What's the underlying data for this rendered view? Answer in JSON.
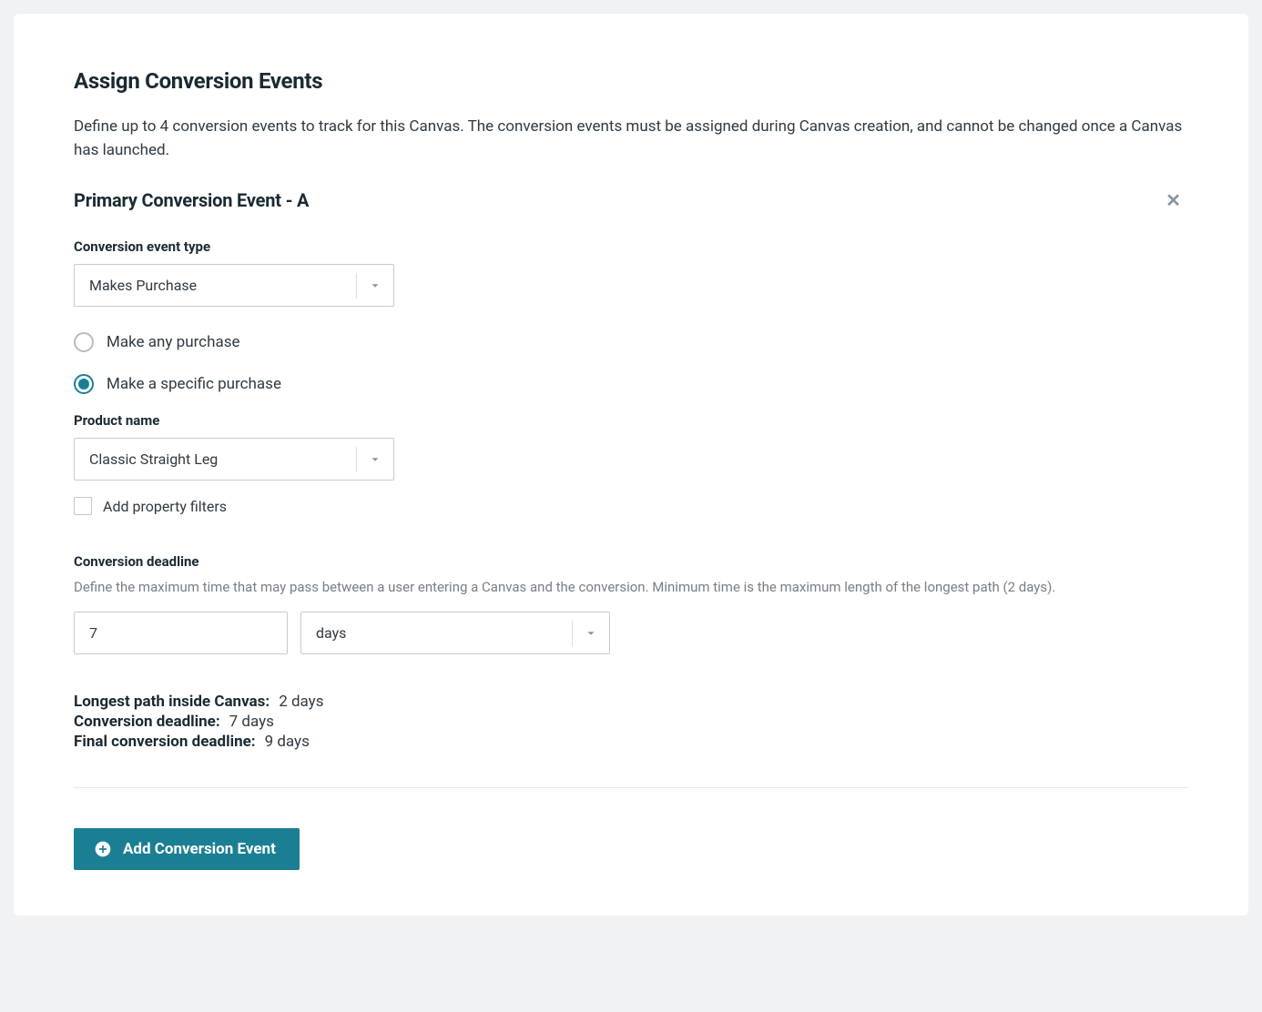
{
  "header": {
    "title": "Assign Conversion Events",
    "description": "Define up to 4 conversion events to track for this Canvas. The conversion events must be assigned during Canvas creation, and cannot be changed once a Canvas has launched."
  },
  "event": {
    "title": "Primary Conversion Event - A",
    "type_label": "Conversion event type",
    "type_value": "Makes Purchase",
    "radio_any": "Make any purchase",
    "radio_specific": "Make a specific purchase",
    "selected_radio": "specific",
    "product_label": "Product name",
    "product_value": "Classic Straight Leg",
    "filters_label": "Add property filters",
    "filters_checked": false
  },
  "deadline": {
    "label": "Conversion deadline",
    "help": "Define the maximum time that may pass between a user entering a Canvas and the conversion. Minimum time is the maximum length of the longest path (2 days).",
    "value": "7",
    "unit": "days"
  },
  "summary": {
    "longest_label": "Longest path inside Canvas:",
    "longest_value": "2 days",
    "deadline_label": "Conversion deadline:",
    "deadline_value": "7 days",
    "final_label": "Final conversion deadline:",
    "final_value": "9 days"
  },
  "actions": {
    "add_label": "Add Conversion Event"
  }
}
